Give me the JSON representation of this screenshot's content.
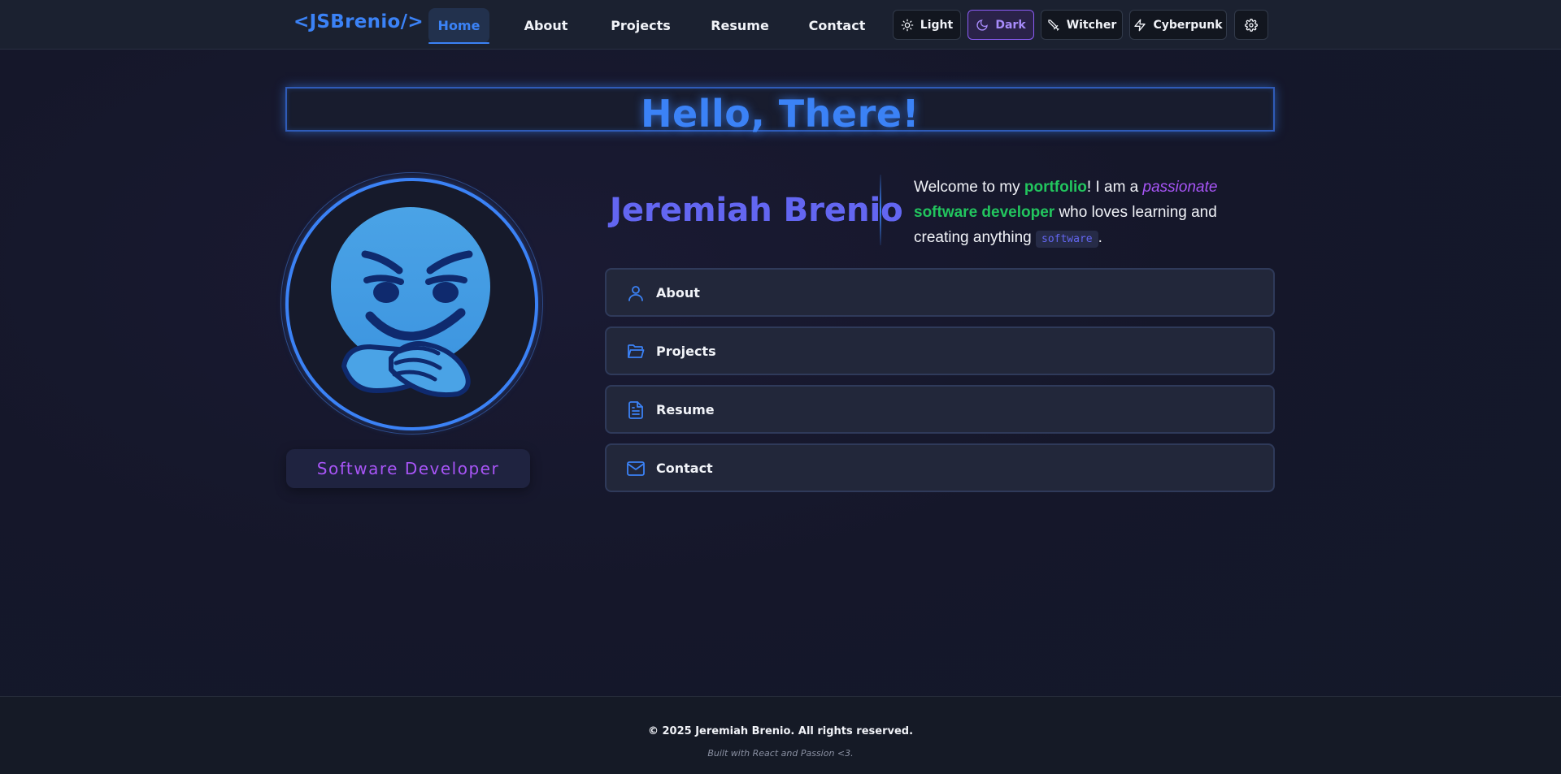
{
  "brand": "<JSBrenio/>",
  "nav": {
    "links": [
      "Home",
      "About",
      "Projects",
      "Resume",
      "Contact"
    ],
    "active": "Home"
  },
  "themes": {
    "buttons": [
      {
        "label": "Light",
        "icon": "sun-icon"
      },
      {
        "label": "Dark",
        "icon": "moon-icon"
      },
      {
        "label": "Witcher",
        "icon": "sword-icon"
      },
      {
        "label": "Cyberpunk",
        "icon": "lightning-icon"
      }
    ],
    "active": "Dark",
    "settings_icon": "gear-icon"
  },
  "hero": {
    "title": "Hello, There!"
  },
  "profile": {
    "avatar_icon": "smirking-emoji-avatar",
    "role": "Software Developer",
    "name": "Jeremiah Brenio"
  },
  "welcome": {
    "t1": "Welcome to my ",
    "portfolio": "portfolio",
    "t2": "! I am a ",
    "passionate": "passionate",
    "t3": " ",
    "role": "software developer",
    "t4": " who loves learning and creating anything ",
    "code": "software",
    "t5": "."
  },
  "menu": [
    {
      "label": "About",
      "icon": "user-icon"
    },
    {
      "label": "Projects",
      "icon": "folder-open-icon"
    },
    {
      "label": "Resume",
      "icon": "document-icon"
    },
    {
      "label": "Contact",
      "icon": "mail-icon"
    }
  ],
  "footer": {
    "copyright": "© 2025 Jeremiah Brenio. All rights reserved.",
    "built": "Built with React and Passion <3."
  },
  "colors": {
    "accent_blue": "#3b82f6",
    "accent_purple": "#a855f7",
    "accent_green": "#22c55e",
    "accent_indigo": "#6366f1",
    "background": "#15172a"
  }
}
